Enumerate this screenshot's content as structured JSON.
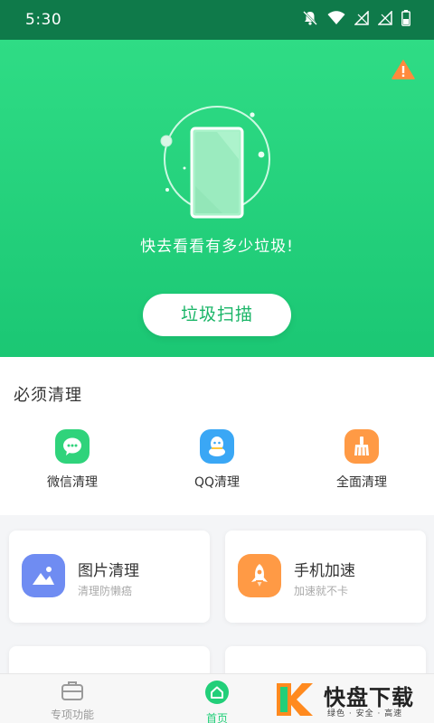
{
  "status_bar": {
    "time": "5:30",
    "icons": [
      "bell-off-icon",
      "wifi-icon",
      "signal-off-icon",
      "signal-off-icon",
      "battery-icon"
    ]
  },
  "hero": {
    "warning_icon": "warning-icon",
    "message": "快去看看有多少垃圾!",
    "scan_button": "垃圾扫描"
  },
  "must_clean": {
    "title": "必须清理",
    "items": [
      {
        "label": "微信清理",
        "icon": "wechat-icon",
        "color": "#2fd37b"
      },
      {
        "label": "QQ清理",
        "icon": "qq-icon",
        "color": "#3aa7f5"
      },
      {
        "label": "全面清理",
        "icon": "broom-icon",
        "color": "#ff9a45"
      }
    ]
  },
  "cards": [
    {
      "title": "图片清理",
      "subtitle": "清理防懒癌",
      "icon": "picture-icon",
      "color": "#6f8cf2"
    },
    {
      "title": "手机加速",
      "subtitle": "加速就不卡",
      "icon": "rocket-icon",
      "color": "#ff9a45"
    }
  ],
  "bottom_nav": {
    "items": [
      {
        "label": "专项功能",
        "icon": "briefcase-icon",
        "active": false
      },
      {
        "label": "首页",
        "icon": "home-icon",
        "active": true
      }
    ]
  },
  "watermark": {
    "title": "快盘下载",
    "subtitle": "绿色 · 安全 · 高速"
  },
  "colors": {
    "primary_green": "#22cf79",
    "status_bar": "#0f7a4a",
    "accent_orange": "#ff9a45"
  }
}
